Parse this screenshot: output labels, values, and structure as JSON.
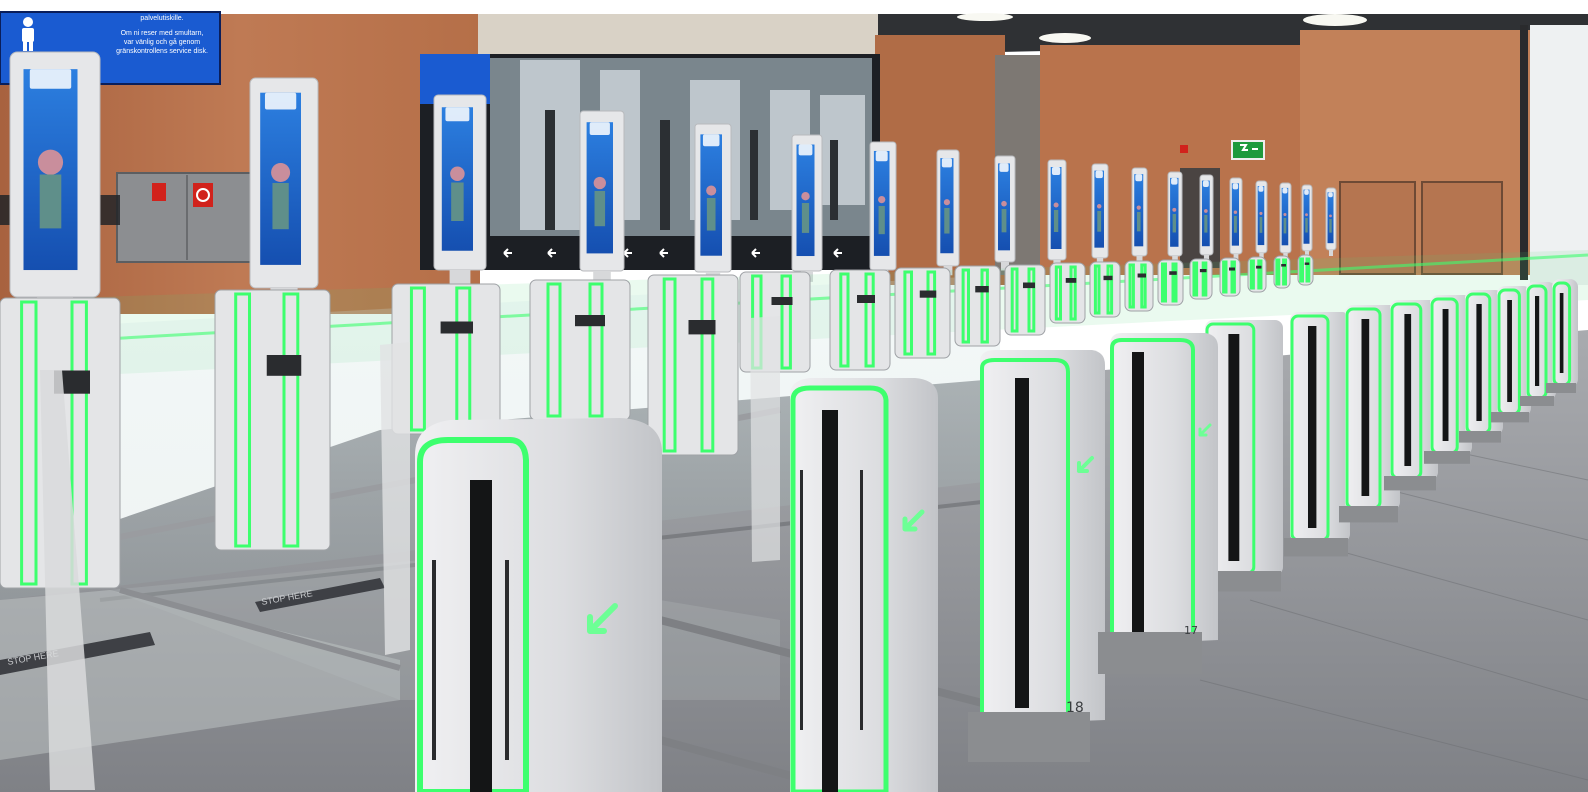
{
  "sign": {
    "line1": "palvelutiskille.",
    "line2": "Om ni reser med smultarn,",
    "line3": "var vänlig och gå genom",
    "line4": "gränskontrollens service disk."
  },
  "floor_markings": {
    "stop_here_a": "STOP HERE",
    "stop_here_b": "STOP HERE"
  },
  "gate_numbers": {
    "gate_17": "17",
    "gate_18": "18"
  },
  "colors": {
    "accent_green": "#3dff6e",
    "wall_wood": "#b9714a",
    "screen_blue": "#1e6fd9",
    "floor_granite": "#8e9094"
  },
  "icons": [
    "arrow-down-left-icon",
    "arrow-left-icon",
    "exit-sign-icon",
    "fire-hose-icon"
  ]
}
